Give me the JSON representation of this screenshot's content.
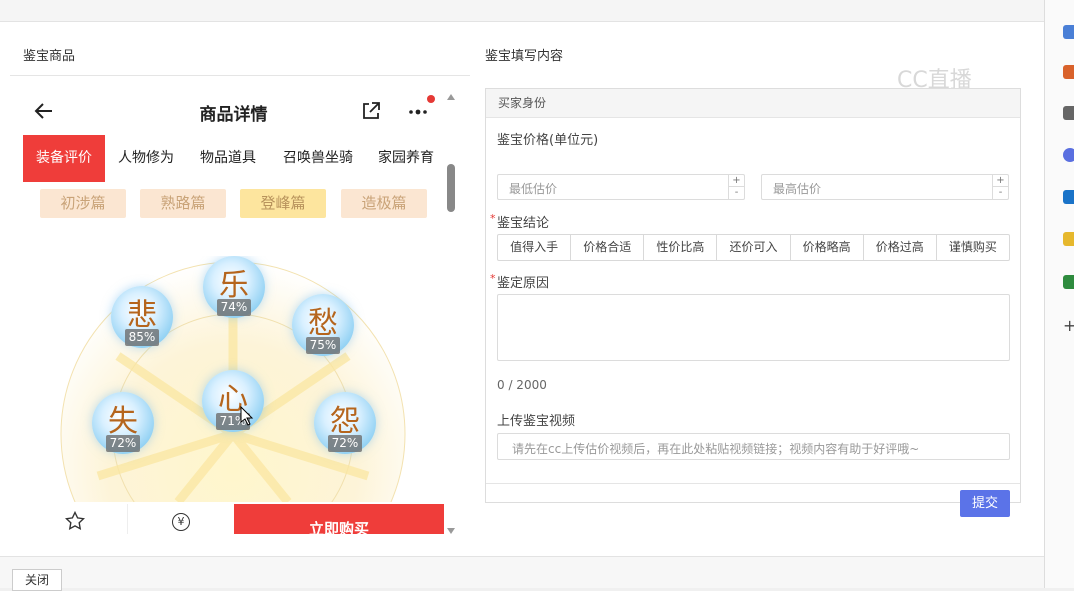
{
  "left_section": {
    "title": "鉴宝商品"
  },
  "right_section": {
    "title": "鉴宝填写内容"
  },
  "watermark": "CC直播",
  "phone": {
    "title": "商品详情",
    "tabs": [
      "装备评价",
      "人物修为",
      "物品道具",
      "召唤兽坐骑",
      "家园养育"
    ],
    "levels": [
      "初涉篇",
      "熟路篇",
      "登峰篇",
      "造极篇"
    ],
    "orbs": [
      {
        "char": "乐",
        "pct": "74%"
      },
      {
        "char": "悲",
        "pct": "85%"
      },
      {
        "char": "愁",
        "pct": "75%"
      },
      {
        "char": "心",
        "pct": "71%"
      },
      {
        "char": "失",
        "pct": "72%"
      },
      {
        "char": "怨",
        "pct": "72%"
      }
    ],
    "bottom": {
      "favorite": "收藏",
      "bargain": "还价",
      "bargain_symbol": "¥",
      "buy": "立即购买"
    }
  },
  "form": {
    "header": "买家身份",
    "price_label": "鉴宝价格(单位元)",
    "min_placeholder": "最低估价",
    "max_placeholder": "最高估价",
    "spin_up": "+",
    "spin_down": "-",
    "required_mark": "*",
    "conclusion_label": "鉴宝结论",
    "conclusions": [
      "值得入手",
      "价格合适",
      "性价比高",
      "还价可入",
      "价格略高",
      "价格过高",
      "谨慎购买"
    ],
    "reason_label": "鉴定原因",
    "counter": "0 / 2000",
    "video_label": "上传鉴宝视频",
    "video_placeholder": "请先在cc上传估价视频后，再在此处粘贴视频链接；视频内容有助于好评哦~",
    "submit": "提交"
  },
  "footer": {
    "close": "关闭"
  },
  "colors": {
    "accent_red": "#ef3d3a",
    "submit_blue": "#5b73e8",
    "orb_blue": "#8fd0f3"
  },
  "icons": [
    "back-arrow-icon",
    "share-icon",
    "more-icon",
    "star-icon",
    "yen-icon",
    "cursor-icon"
  ]
}
